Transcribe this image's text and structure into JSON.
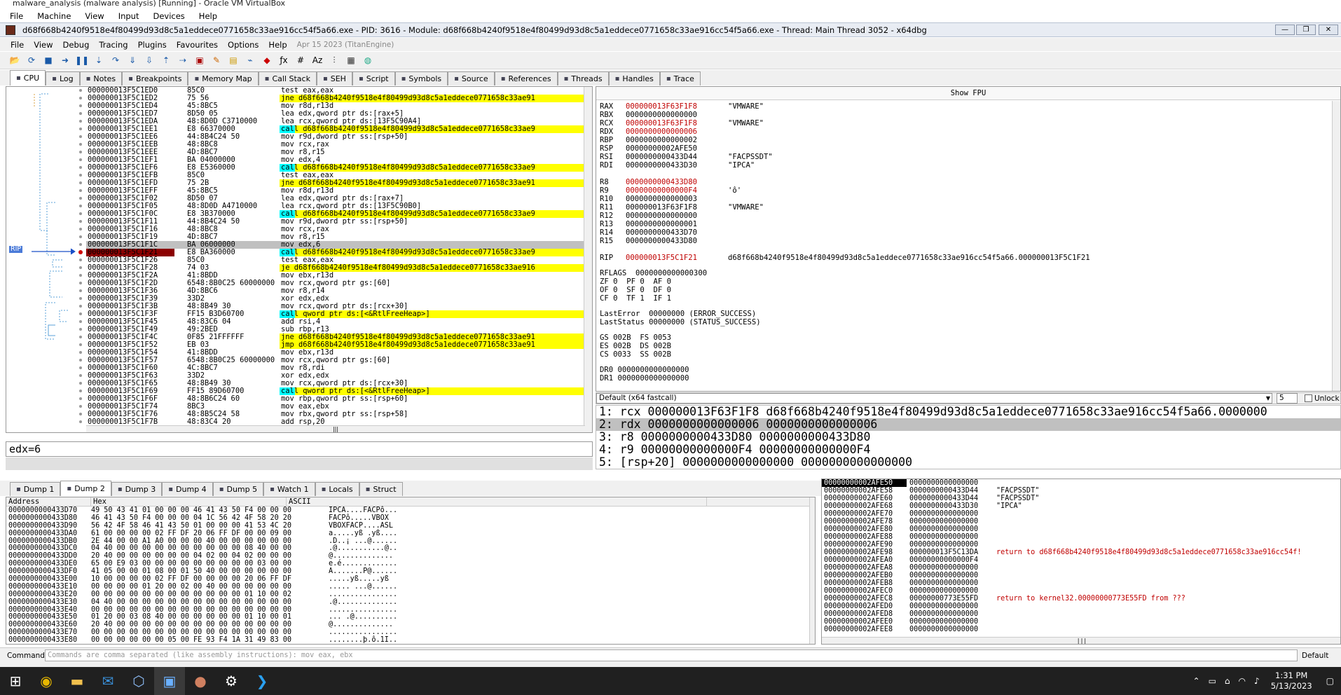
{
  "vbox": {
    "title": "malware_analysis (malware analysis) [Running] - Oracle VM VirtualBox",
    "menu": [
      "File",
      "Machine",
      "View",
      "Input",
      "Devices",
      "Help"
    ]
  },
  "x64dbg": {
    "title": "d68f668b4240f9518e4f80499d93d8c5a1eddece0771658c33ae916cc54f5a66.exe - PID: 3616 - Module: d68f668b4240f9518e4f80499d93d8c5a1eddece0771658c33ae916cc54f5a66.exe - Thread: Main Thread 3052 - x64dbg",
    "menu": [
      "File",
      "View",
      "Debug",
      "Tracing",
      "Plugins",
      "Favourites",
      "Options",
      "Help"
    ],
    "version": "Apr 15 2023 (TitanEngine)"
  },
  "tabs": [
    {
      "label": "CPU",
      "icon": "cpu-icon"
    },
    {
      "label": "Log",
      "icon": "log-icon"
    },
    {
      "label": "Notes",
      "icon": "notes-icon"
    },
    {
      "label": "Breakpoints",
      "icon": "breakpoint-icon"
    },
    {
      "label": "Memory Map",
      "icon": "memory-icon"
    },
    {
      "label": "Call Stack",
      "icon": "callstack-icon"
    },
    {
      "label": "SEH",
      "icon": "seh-icon"
    },
    {
      "label": "Script",
      "icon": "script-icon"
    },
    {
      "label": "Symbols",
      "icon": "symbols-icon"
    },
    {
      "label": "Source",
      "icon": "source-icon"
    },
    {
      "label": "References",
      "icon": "references-icon"
    },
    {
      "label": "Threads",
      "icon": "threads-icon"
    },
    {
      "label": "Handles",
      "icon": "handles-icon"
    },
    {
      "label": "Trace",
      "icon": "trace-icon"
    }
  ],
  "disasm": [
    [
      "000000013F5C1ED0",
      "85C0",
      "test eax,eax",
      ""
    ],
    [
      "000000013F5C1ED2",
      "75 56",
      "jne d68f668b4240f9518e4f80499d93d8c5a1eddece0771658c33ae91",
      "j"
    ],
    [
      "000000013F5C1ED4",
      "45:8BC5",
      "mov r8d,r13d",
      ""
    ],
    [
      "000000013F5C1ED7",
      "8D50 05",
      "lea edx,qword ptr ds:[rax+5]",
      ""
    ],
    [
      "000000013F5C1EDA",
      "48:8D0D C3710000",
      "lea rcx,qword ptr ds:[13F5C90A4]",
      ""
    ],
    [
      "000000013F5C1EE1",
      "E8 66370000",
      "call d68f668b4240f9518e4f80499d93d8c5a1eddece0771658c33ae9",
      "c"
    ],
    [
      "000000013F5C1EE6",
      "44:8B4C24 50",
      "mov r9d,dword ptr ss:[rsp+50]",
      ""
    ],
    [
      "000000013F5C1EEB",
      "48:8BC8",
      "mov rcx,rax",
      ""
    ],
    [
      "000000013F5C1EEE",
      "4D:8BC7",
      "mov r8,r15",
      ""
    ],
    [
      "000000013F5C1EF1",
      "BA 04000000",
      "mov edx,4",
      ""
    ],
    [
      "000000013F5C1EF6",
      "E8 E5360000",
      "call d68f668b4240f9518e4f80499d93d8c5a1eddece0771658c33ae9",
      "c"
    ],
    [
      "000000013F5C1EFB",
      "85C0",
      "test eax,eax",
      ""
    ],
    [
      "000000013F5C1EFD",
      "75 2B",
      "jne d68f668b4240f9518e4f80499d93d8c5a1eddece0771658c33ae91",
      "j"
    ],
    [
      "000000013F5C1EFF",
      "45:8BC5",
      "mov r8d,r13d",
      ""
    ],
    [
      "000000013F5C1F02",
      "8D50 07",
      "lea edx,qword ptr ds:[rax+7]",
      ""
    ],
    [
      "000000013F5C1F05",
      "48:8D0D A4710000",
      "lea rcx,qword ptr ds:[13F5C90B0]",
      ""
    ],
    [
      "000000013F5C1F0C",
      "E8 3B370000",
      "call d68f668b4240f9518e4f80499d93d8c5a1eddece0771658c33ae9",
      "c"
    ],
    [
      "000000013F5C1F11",
      "44:8B4C24 50",
      "mov r9d,dword ptr ss:[rsp+50]",
      ""
    ],
    [
      "000000013F5C1F16",
      "48:8BC8",
      "mov rcx,rax",
      ""
    ],
    [
      "000000013F5C1F19",
      "4D:8BC7",
      "mov r8,r15",
      ""
    ],
    [
      "000000013F5C1F1C",
      "BA 06000000",
      "mov edx,6",
      "hl"
    ],
    [
      "000000013F5C1F21",
      "E8 BA360000",
      "call d68f668b4240f9518e4f80499d93d8c5a1eddece0771658c33ae9",
      "rip"
    ],
    [
      "000000013F5C1F26",
      "85C0",
      "test eax,eax",
      ""
    ],
    [
      "000000013F5C1F28",
      "74 03",
      "je d68f668b4240f9518e4f80499d93d8c5a1eddece0771658c33ae916",
      "j"
    ],
    [
      "000000013F5C1F2A",
      "41:8BDD",
      "mov ebx,r13d",
      ""
    ],
    [
      "000000013F5C1F2D",
      "6548:8B0C25 60000000",
      "mov rcx,qword ptr gs:[60]",
      ""
    ],
    [
      "000000013F5C1F36",
      "4D:8BC6",
      "mov r8,r14",
      ""
    ],
    [
      "000000013F5C1F39",
      "33D2",
      "xor edx,edx",
      ""
    ],
    [
      "000000013F5C1F3B",
      "48:8B49 30",
      "mov rcx,qword ptr ds:[rcx+30]",
      ""
    ],
    [
      "000000013F5C1F3F",
      "FF15 B3D60700",
      "call qword ptr ds:[<&RtlFreeHeap>]",
      "c"
    ],
    [
      "000000013F5C1F45",
      "48:83C6 04",
      "add rsi,4",
      ""
    ],
    [
      "000000013F5C1F49",
      "49:2BED",
      "sub rbp,r13",
      ""
    ],
    [
      "000000013F5C1F4C",
      "0F85 21FFFFFF",
      "jne d68f668b4240f9518e4f80499d93d8c5a1eddece0771658c33ae91",
      "j"
    ],
    [
      "000000013F5C1F52",
      "EB 03",
      "jmp d68f668b4240f9518e4f80499d93d8c5a1eddece0771658c33ae91",
      "j"
    ],
    [
      "000000013F5C1F54",
      "41:8BDD",
      "mov ebx,r13d",
      ""
    ],
    [
      "000000013F5C1F57",
      "6548:8B0C25 60000000",
      "mov rcx,qword ptr gs:[60]",
      ""
    ],
    [
      "000000013F5C1F60",
      "4C:8BC7",
      "mov r8,rdi",
      ""
    ],
    [
      "000000013F5C1F63",
      "33D2",
      "xor edx,edx",
      ""
    ],
    [
      "000000013F5C1F65",
      "48:8B49 30",
      "mov rcx,qword ptr ds:[rcx+30]",
      ""
    ],
    [
      "000000013F5C1F69",
      "FF15 89D60700",
      "call qword ptr ds:[<&RtlFreeHeap>]",
      "c"
    ],
    [
      "000000013F5C1F6F",
      "48:8B6C24 60",
      "mov rbp,qword ptr ss:[rsp+60]",
      ""
    ],
    [
      "000000013F5C1F74",
      "8BC3",
      "mov eax,ebx",
      ""
    ],
    [
      "000000013F5C1F76",
      "48:8B5C24 58",
      "mov rbx,qword ptr ss:[rsp+58]",
      ""
    ],
    [
      "000000013F5C1F7B",
      "48:83C4 20",
      "add rsp,20",
      ""
    ]
  ],
  "rip_label": "RIP",
  "info": "edx=6",
  "regs": {
    "fpu_label": "Show FPU",
    "list": [
      [
        "RAX",
        "000000013F63F1F8",
        "\"VMWARE\"",
        1
      ],
      [
        "RBX",
        "0000000000000000",
        "",
        0
      ],
      [
        "RCX",
        "000000013F63F1F8",
        "\"VMWARE\"",
        1
      ],
      [
        "RDX",
        "0000000000000006",
        "",
        1
      ],
      [
        "RBP",
        "0000000000000002",
        "",
        0
      ],
      [
        "RSP",
        "00000000002AFE50",
        "",
        0
      ],
      [
        "RSI",
        "0000000000433D44",
        "\"FACPSSDT\"",
        0
      ],
      [
        "RDI",
        "0000000000433D30",
        "\"IPCA\"",
        0
      ],
      [
        "",
        "",
        "",
        0
      ],
      [
        "R8",
        "0000000000433D80",
        "",
        1
      ],
      [
        "R9",
        "00000000000000F4",
        "'ô'",
        1
      ],
      [
        "R10",
        "0000000000000003",
        "",
        0
      ],
      [
        "R11",
        "000000013F63F1F8",
        "\"VMWARE\"",
        0
      ],
      [
        "R12",
        "0000000000000000",
        "",
        0
      ],
      [
        "R13",
        "0000000000000001",
        "",
        0
      ],
      [
        "R14",
        "0000000000433D70",
        "",
        0
      ],
      [
        "R15",
        "0000000000433D80",
        "",
        0
      ],
      [
        "",
        "",
        "",
        0
      ],
      [
        "RIP",
        "000000013F5C1F21",
        "d68f668b4240f9518e4f80499d93d8c5a1eddece0771658c33ae916cc54f5a66.000000013F5C1F21",
        1
      ]
    ],
    "rflags": "RFLAGS  0000000000000300",
    "flags": [
      "ZF 0  PF 0  AF 0",
      "OF 0  SF 0  DF 0",
      "CF 0  TF 1  IF 1"
    ],
    "last": [
      "LastError  00000000 (ERROR_SUCCESS)",
      "LastStatus 00000000 (STATUS_SUCCESS)"
    ],
    "seg": [
      "GS 002B  FS 0053",
      "ES 002B  DS 002B",
      "CS 0033  SS 002B"
    ],
    "dr": [
      "DR0 0000000000000000",
      "DR1 0000000000000000"
    ]
  },
  "callconv": {
    "label": "Default (x64 fastcall)",
    "count": "5",
    "unlock": "Unlock"
  },
  "args": [
    "1: rcx 000000013F63F1F8 d68f668b4240f9518e4f80499d93d8c5a1eddece0771658c33ae916cc54f5a66.0000000",
    "2: rdx 0000000000000006 0000000000000006",
    "3: r8 0000000000433D80 0000000000433D80",
    "4: r9 00000000000000F4 00000000000000F4",
    "5: [rsp+20] 0000000000000000 0000000000000000"
  ],
  "dtabs": [
    {
      "label": "Dump 1",
      "icon": "dump-icon"
    },
    {
      "label": "Dump 2",
      "icon": "dump-icon"
    },
    {
      "label": "Dump 3",
      "icon": "dump-icon"
    },
    {
      "label": "Dump 4",
      "icon": "dump-icon"
    },
    {
      "label": "Dump 5",
      "icon": "dump-icon"
    },
    {
      "label": "Watch 1",
      "icon": "watch-icon"
    },
    {
      "label": "Locals",
      "icon": "locals-icon"
    },
    {
      "label": "Struct",
      "icon": "struct-icon"
    }
  ],
  "dump": {
    "headers": [
      "Address",
      "Hex",
      "ASCII"
    ],
    "rows": [
      [
        "0000000000433D70",
        "49 50 43 41 01 00 00 00 46 41 43 50 F4 00 00 00",
        "IPCA....FACPô..."
      ],
      [
        "0000000000433D80",
        "46 41 43 50 F4 00 00 00 04 1C 56 42 4F 58 20 20",
        "FACPô.....VBOX  "
      ],
      [
        "0000000000433D90",
        "56 42 4F 58 46 41 43 50 01 00 00 00 41 53 4C 20",
        "VBOXFACP....ASL "
      ],
      [
        "0000000000433DA0",
        "61 00 00 00 00 02 FF DF 20 06 FF DF 00 00 09 00",
        "a.....yß .yß...."
      ],
      [
        "0000000000433DB0",
        "2E 44 00 00 A1 A0 00 00 00 40 00 00 00 00 00 00",
        ".D..¡ ...@......"
      ],
      [
        "0000000000433DC0",
        "04 40 00 00 00 00 00 00 00 00 00 00 08 40 00 00",
        ".@...........@.."
      ],
      [
        "0000000000433DD0",
        "20 40 00 00 00 00 00 00 04 02 00 04 02 00 00 00",
        " @.............."
      ],
      [
        "0000000000433DE0",
        "65 00 E9 03 00 00 00 00 00 00 00 00 00 03 00 00",
        "e.é............."
      ],
      [
        "0000000000433DF0",
        "41 05 00 00 01 08 00 01 50 40 00 00 00 00 00 00",
        "A.......P@......"
      ],
      [
        "0000000000433E00",
        "10 00 00 00 00 02 FF DF 00 00 00 00 20 06 FF DF",
        ".....yß.....yß"
      ],
      [
        "0000000000433E10",
        "00 00 00 00 01 20 00 02 00 40 00 00 00 00 00 00",
        "..... ...@......"
      ],
      [
        "0000000000433E20",
        "00 00 00 00 00 00 00 00 00 00 00 00 01 10 00 02",
        "................"
      ],
      [
        "0000000000433E30",
        "04 40 00 00 00 00 00 00 00 00 00 00 00 00 00 00",
        ".@.............."
      ],
      [
        "0000000000433E40",
        "00 00 00 00 00 00 00 00 00 00 00 00 00 00 00 00",
        "................"
      ],
      [
        "0000000000433E50",
        "01 20 00 03 08 40 00 00 00 00 00 00 01 10 00 01",
        "... .@.........."
      ],
      [
        "0000000000433E60",
        "20 40 00 00 00 00 00 00 00 00 00 00 00 00 00 00",
        " @.............."
      ],
      [
        "0000000000433E70",
        "00 00 00 00 00 00 00 00 00 00 00 00 00 00 00 00",
        "................"
      ],
      [
        "0000000000433E80",
        "00 00 00 00 00 00 05 00 FE 93 F4 1A 31 49 83 00",
        "........þ.ô.1I.."
      ]
    ]
  },
  "stack": [
    [
      "00000000002AFE50",
      "0000000000000000",
      "",
      0
    ],
    [
      "00000000002AFE58",
      "0000000000433D44",
      "\"FACPSSDT\"",
      0
    ],
    [
      "00000000002AFE60",
      "0000000000433D44",
      "\"FACPSSDT\"",
      0
    ],
    [
      "00000000002AFE68",
      "0000000000433D30",
      "\"IPCA\"",
      0
    ],
    [
      "00000000002AFE70",
      "0000000000000000",
      "",
      0
    ],
    [
      "00000000002AFE78",
      "0000000000000000",
      "",
      0
    ],
    [
      "00000000002AFE80",
      "0000000000000000",
      "",
      0
    ],
    [
      "00000000002AFE88",
      "0000000000000000",
      "",
      0
    ],
    [
      "00000000002AFE90",
      "0000000000000000",
      "",
      0
    ],
    [
      "00000000002AFE98",
      "000000013F5C13DA",
      "return to d68f668b4240f9518e4f80499d93d8c5a1eddece0771658c33ae916cc54f!",
      1
    ],
    [
      "00000000002AFEA0",
      "00000000000000F4",
      "",
      0
    ],
    [
      "00000000002AFEA8",
      "0000000000000000",
      "",
      0
    ],
    [
      "00000000002AFEB0",
      "0000000000000000",
      "",
      0
    ],
    [
      "00000000002AFEB8",
      "0000000000000000",
      "",
      0
    ],
    [
      "00000000002AFEC0",
      "0000000000000000",
      "",
      0
    ],
    [
      "00000000002AFEC8",
      "00000000773E55FD",
      "return to kernel32.00000000773E55FD from ???",
      1
    ],
    [
      "00000000002AFED0",
      "0000000000000000",
      "",
      0
    ],
    [
      "00000000002AFED8",
      "0000000000000000",
      "",
      0
    ],
    [
      "00000000002AFEE0",
      "0000000000000000",
      "",
      0
    ],
    [
      "00000000002AFEE8",
      "0000000000000000",
      "",
      0
    ]
  ],
  "cmd": {
    "label": "Command:",
    "placeholder": "Commands are comma separated (like assembly instructions): mov eax, ebx",
    "mode": "Default"
  },
  "clock": {
    "time": "1:31 PM",
    "date": "5/13/2023"
  }
}
